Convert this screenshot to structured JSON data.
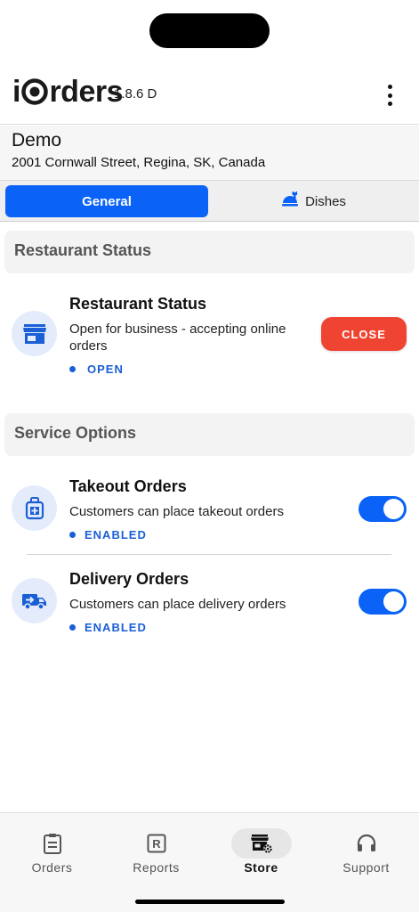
{
  "header": {
    "logo_left": "i",
    "logo_right": "rders",
    "version": "1.8.6 D"
  },
  "restaurant": {
    "name": "Demo",
    "address": "2001 Cornwall Street, Regina, SK, Canada"
  },
  "tabs": {
    "general": "General",
    "dishes": "Dishes",
    "active": "General"
  },
  "restaurant_status_section": {
    "header": "Restaurant Status",
    "title": "Restaurant Status",
    "description": "Open for business - accepting online orders",
    "status": "OPEN",
    "button": "CLOSE"
  },
  "service_options": {
    "header": "Service Options",
    "takeout": {
      "title": "Takeout Orders",
      "description": "Customers can place takeout orders",
      "status": "ENABLED",
      "enabled": true
    },
    "delivery": {
      "title": "Delivery Orders",
      "description": "Customers can place delivery orders",
      "status": "ENABLED",
      "enabled": true
    }
  },
  "bottom_nav": {
    "items": [
      {
        "label": "Orders",
        "icon": "clipboard-icon"
      },
      {
        "label": "Reports",
        "icon": "report-icon"
      },
      {
        "label": "Store",
        "icon": "store-settings-icon"
      },
      {
        "label": "Support",
        "icon": "headphones-icon"
      }
    ],
    "active": "Store"
  },
  "colors": {
    "primary": "#0a63f6",
    "status_blue": "#1a5fd6",
    "close_red": "#f04433",
    "icon_bg": "#e4ecfb"
  }
}
